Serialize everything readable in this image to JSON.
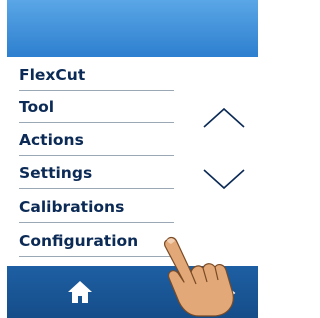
{
  "menu": {
    "items": [
      {
        "label": "FlexCut"
      },
      {
        "label": "Tool"
      },
      {
        "label": "Actions"
      },
      {
        "label": "Settings"
      },
      {
        "label": "Calibrations"
      },
      {
        "label": "Configuration"
      }
    ]
  },
  "icons": {
    "scroll_up": "chevron-up-icon",
    "scroll_down": "chevron-down-icon",
    "home": "home-icon",
    "pointer": "hand-pointer-icon"
  },
  "colors": {
    "topbar": "#3c8fdc",
    "bottombar": "#1a5798",
    "menu_text": "#0b2a55"
  }
}
